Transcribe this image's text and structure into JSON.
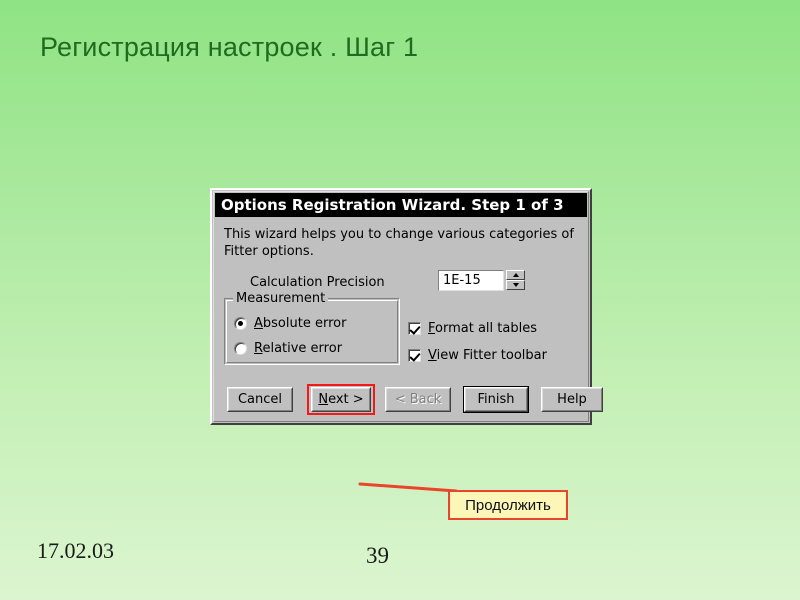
{
  "slide": {
    "title": "Регистрация настроек . Шаг 1",
    "date": "17.02.03",
    "number": "39",
    "background_top_color": "#8FE383",
    "background_bottom_color": "#DCF5D0",
    "title_color": "#1F6B1F"
  },
  "dialog": {
    "titlebar": "Options Registration Wizard. Step 1 of 3",
    "intro_text": "This wizard helps you to change various categories of Fitter options.",
    "precision": {
      "label": "Calculation Precision",
      "value": "1E-15",
      "spinner_up": "spinner-up-arrow",
      "spinner_down": "spinner-down-arrow"
    },
    "measurement": {
      "legend": "Measurement",
      "options": [
        {
          "label_acc": "A",
          "label_rest": "bsolute error",
          "checked": true
        },
        {
          "label_acc": "R",
          "label_rest": "elative error",
          "checked": false
        }
      ]
    },
    "checkboxes": [
      {
        "label_acc": "F",
        "label_rest": "ormat all tables",
        "checked": true
      },
      {
        "label_acc": "V",
        "label_rest": "iew Fitter toolbar",
        "checked": true
      }
    ],
    "buttons": [
      {
        "label": "Cancel",
        "state": "normal"
      },
      {
        "label_acc": "N",
        "label_rest": "ext >",
        "state": "highlighted"
      },
      {
        "label": "< Back",
        "state": "disabled"
      },
      {
        "label": "Finish",
        "state": "default"
      },
      {
        "label": "Help",
        "state": "normal"
      }
    ],
    "highlight_color": "#F01A1A"
  },
  "callout": {
    "text": "Продолжить",
    "fill_color": "#FCF7B8",
    "border_color": "#E8452C"
  }
}
